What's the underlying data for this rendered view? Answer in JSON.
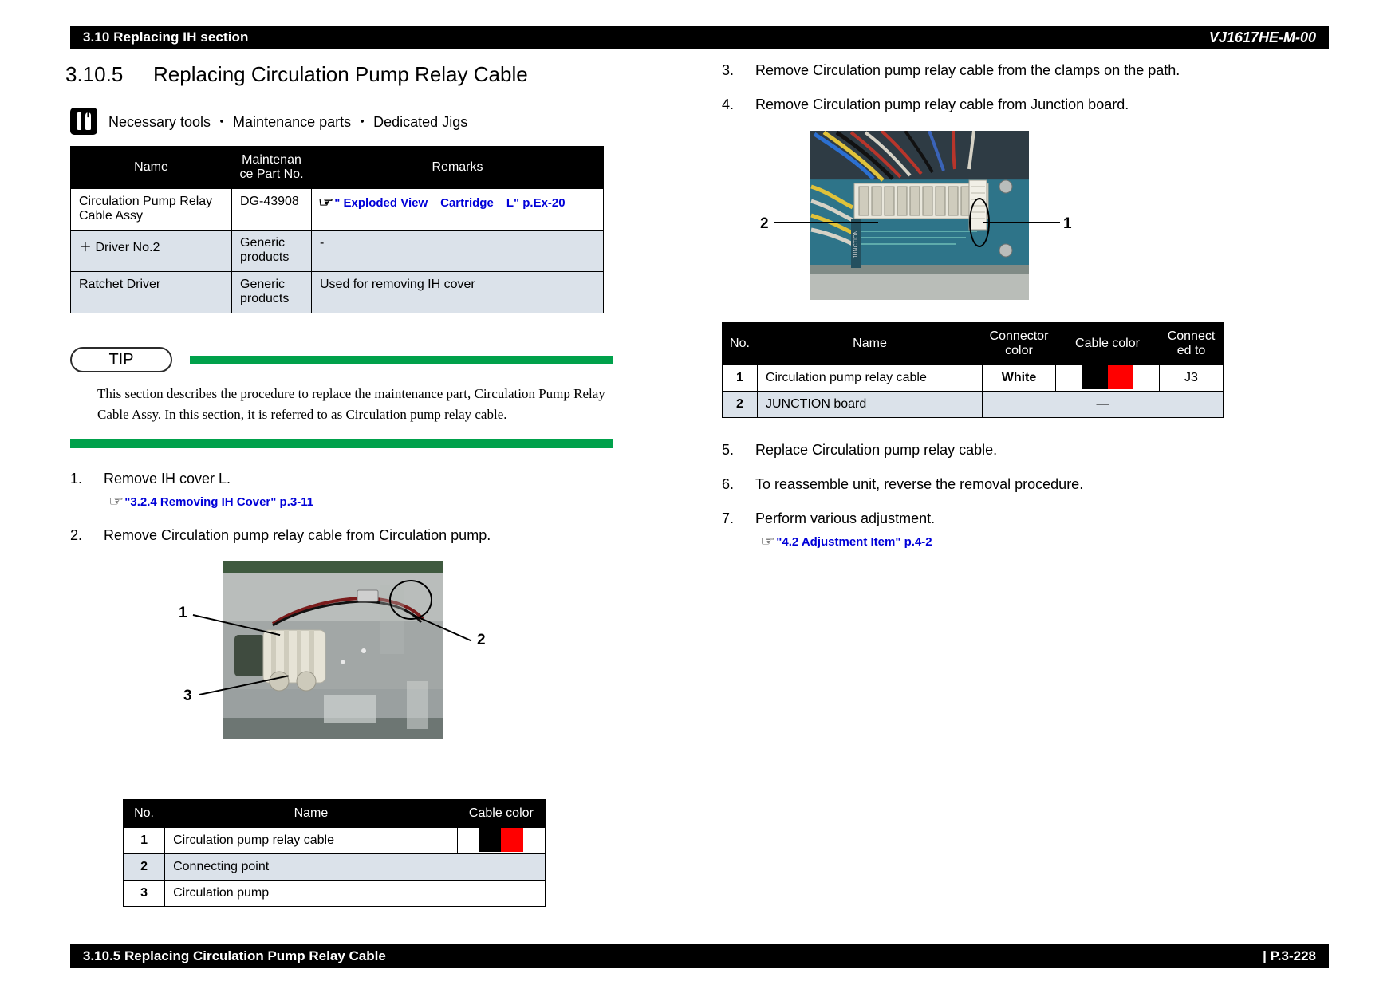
{
  "header": {
    "left": "3.10 Replacing IH section",
    "right": "VJ1617HE-M-00"
  },
  "footer": {
    "left": "3.10.5 Replacing Circulation Pump Relay Cable",
    "right": "| P.3-228"
  },
  "section": {
    "number": "3.10.5",
    "title": "Replacing Circulation Pump Relay Cable"
  },
  "tools": {
    "heading": "Necessary tools ・ Maintenance parts ・ Dedicated Jigs",
    "icon": "tools-icon",
    "columns": [
      "Name",
      "Maintenan ce Part No.",
      "Remarks"
    ],
    "col_name": "Name",
    "col_partno_line1": "Maintenan",
    "col_partno_line2": "ce Part No.",
    "col_remarks": "Remarks",
    "rows": [
      {
        "name": "Circulation Pump Relay Cable Assy",
        "part_no": "DG-43908",
        "remarks_link_1": "\" Exploded View",
        "remarks_link_2": "Cartridge",
        "remarks_link_3": "L\" p.Ex-20",
        "remarks_is_link": true
      },
      {
        "name": "＋ Driver No.2",
        "part_no": "Generic products",
        "remarks": "-",
        "remarks_is_link": false
      },
      {
        "name": "Ratchet Driver",
        "part_no": "Generic products",
        "remarks": "Used for removing IH cover",
        "remarks_is_link": false
      }
    ]
  },
  "tip": {
    "badge": "TIP",
    "body": "This section describes the procedure to replace the maintenance part, Circulation Pump Relay Cable Assy. In this section, it is referred to as Circulation pump relay cable.",
    "bar_color": "#00a14b"
  },
  "steps_left": [
    {
      "num": "1.",
      "text": "Remove IH cover L.",
      "link": "\"3.2.4 Removing IH Cover\" p.3-11"
    },
    {
      "num": "2.",
      "text": "Remove Circulation pump relay cable from Circulation pump.",
      "link": null
    }
  ],
  "steps_right_top": [
    {
      "num": "3.",
      "text": "Remove Circulation pump relay cable from the clamps on the path.",
      "link": null
    },
    {
      "num": "4.",
      "text": "Remove Circulation pump relay cable from Junction board.",
      "link": null
    }
  ],
  "steps_right_bottom": [
    {
      "num": "5.",
      "text": "Replace Circulation pump relay cable.",
      "link": null
    },
    {
      "num": "6.",
      "text": "To reassemble unit, reverse the removal procedure.",
      "link": null
    },
    {
      "num": "7.",
      "text": "Perform various adjustment.",
      "link": "\"4.2 Adjustment Item\" p.4-2"
    }
  ],
  "photo_left": {
    "callouts": [
      "1",
      "2",
      "3"
    ],
    "callout_1": "1",
    "callout_2": "2",
    "callout_3": "3"
  },
  "photo_right": {
    "callout_1": "1",
    "callout_2": "2"
  },
  "table_left": {
    "columns": [
      "No.",
      "Name",
      "Cable color"
    ],
    "col_no": "No.",
    "col_name": "Name",
    "col_cable": "Cable color",
    "rows": [
      {
        "no": "1",
        "name": "Circulation pump relay cable",
        "cable_colors": [
          "#ffffff",
          "#000000",
          "#ff0000",
          "#ffffff"
        ]
      },
      {
        "no": "2",
        "name": "Connecting point",
        "cable_colors": null
      },
      {
        "no": "3",
        "name": "Circulation pump",
        "cable_colors": null
      }
    ]
  },
  "table_right": {
    "col_no": "No.",
    "col_name": "Name",
    "col_connector_l1": "Connector",
    "col_connector_l2": "color",
    "col_cable": "Cable color",
    "col_connected_l1": "Connect",
    "col_connected_l2": "ed to",
    "rows": [
      {
        "no": "1",
        "name": "Circulation pump relay cable",
        "connector_color": "White",
        "cable_colors": [
          "#ffffff",
          "#000000",
          "#ff0000",
          "#ffffff"
        ],
        "connected_to": "J3",
        "merged": false
      },
      {
        "no": "2",
        "name": "JUNCTION board",
        "merged_value": "—",
        "merged": true
      }
    ]
  },
  "colors": {
    "link": "#0000d8",
    "tip_green": "#00a14b",
    "header_bg": "#000000",
    "alt_row": "#dbe2ea"
  }
}
